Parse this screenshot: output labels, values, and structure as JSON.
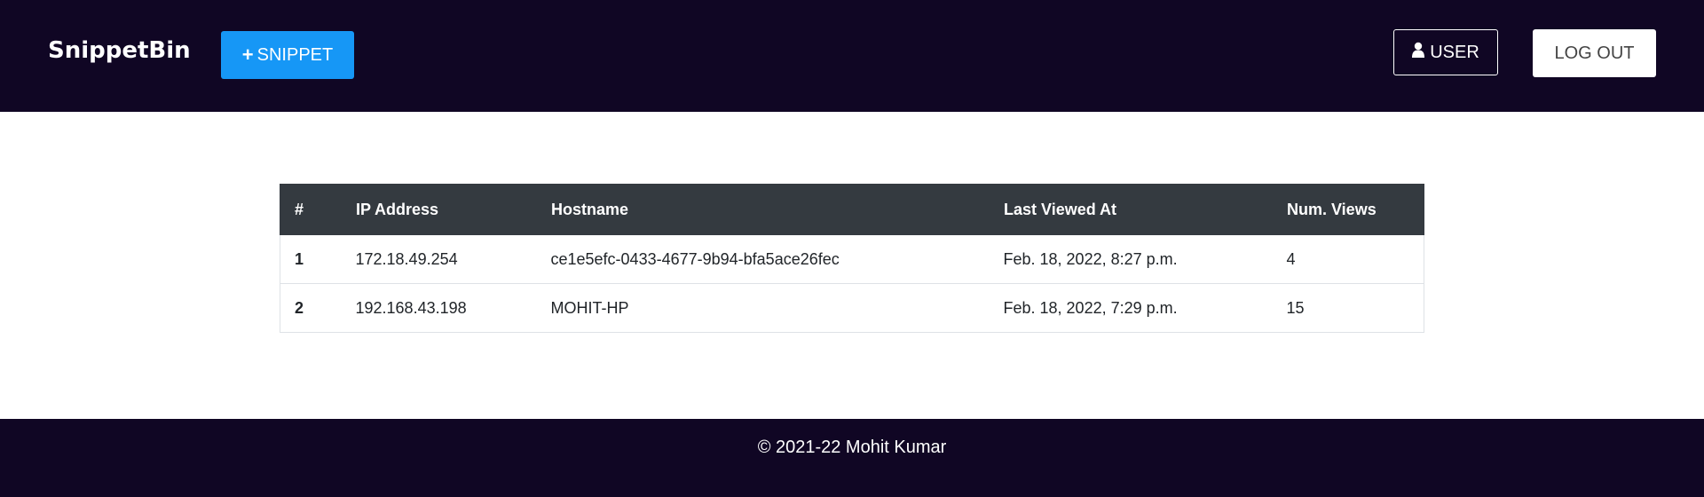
{
  "navbar": {
    "brand": "SnippetBin",
    "snippet_button": {
      "icon": "plus-icon",
      "label": "SNIPPET"
    },
    "user_button": {
      "icon": "user-icon",
      "label": "USER"
    },
    "logout_button": {
      "label": "LOG OUT"
    }
  },
  "table": {
    "headers": [
      "#",
      "IP Address",
      "Hostname",
      "Last Viewed At",
      "Num. Views"
    ],
    "rows": [
      {
        "num": "1",
        "ip": "172.18.49.254",
        "hostname": "ce1e5efc-0433-4677-9b94-bfa5ace26fec",
        "last_viewed": "Feb. 18, 2022, 8:27 p.m.",
        "views": "4"
      },
      {
        "num": "2",
        "ip": "192.168.43.198",
        "hostname": "MOHIT-HP",
        "last_viewed": "Feb. 18, 2022, 7:29 p.m.",
        "views": "15"
      }
    ]
  },
  "footer": {
    "text": "© 2021-22 Mohit Kumar"
  },
  "colors": {
    "navbar_bg": "#100624",
    "accent": "#1697f6",
    "table_header_bg": "#343a40"
  }
}
